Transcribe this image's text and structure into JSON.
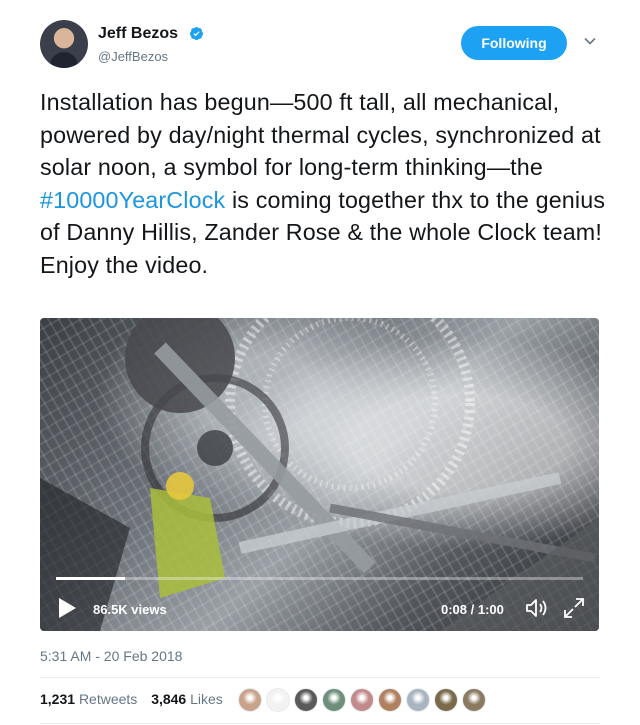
{
  "author": {
    "name": "Jeff Bezos",
    "handle": "@JeffBezos",
    "verified": true,
    "follow_label": "Following",
    "avatar_icon": "profile-photo"
  },
  "tweet": {
    "text_before": "Installation has begun—500 ft tall, all mechanical, powered by day/night thermal cycles, synchronized at solar noon, a symbol for long-term thinking—the ",
    "hashtag": "#10000YearClock",
    "text_after": " is coming together thx to the genius of Danny Hillis, Zander Rose & the whole Clock team! Enjoy the video."
  },
  "video": {
    "views": "86.5K views",
    "time": "0:08 / 1:00",
    "progress": 0.13,
    "play_icon": "play-icon",
    "volume_icon": "volume-icon",
    "fullscreen_icon": "fullscreen-icon"
  },
  "timestamp": "5:31 AM - 20 Feb 2018",
  "stats": {
    "retweets_count": "1,231",
    "retweets_label": "Retweets",
    "likes_count": "3,846",
    "likes_label": "Likes"
  },
  "likers": [
    {
      "color": "#c9a28a"
    },
    {
      "color": "#f2f2f2"
    },
    {
      "color": "#5a5a5a"
    },
    {
      "color": "#6f8f7a"
    },
    {
      "color": "#c28a8a"
    },
    {
      "color": "#b08060"
    },
    {
      "color": "#aab4c0"
    },
    {
      "color": "#7a6a4a"
    },
    {
      "color": "#8a7a60"
    }
  ],
  "colors": {
    "accent": "#1da1f2",
    "link": "#1b95e0",
    "muted": "#657786"
  }
}
